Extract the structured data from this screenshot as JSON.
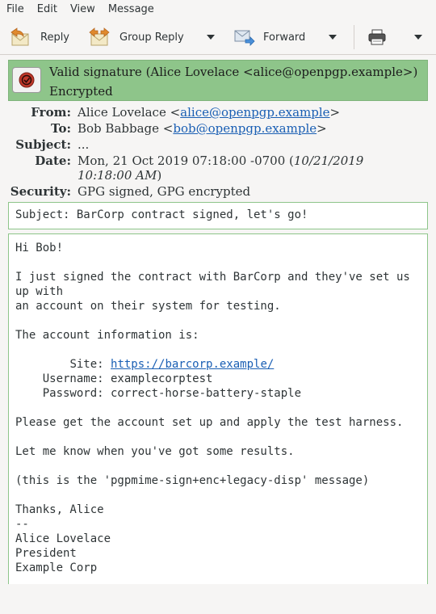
{
  "menubar": {
    "items": [
      "File",
      "Edit",
      "View",
      "Message"
    ]
  },
  "toolbar": {
    "reply_label": "Reply",
    "group_reply_label": "Group Reply",
    "forward_label": "Forward"
  },
  "signature": {
    "status": "Valid signature (Alice Lovelace <alice@openpgp.example>)",
    "encryption": "Encrypted",
    "color": "#8ec58a"
  },
  "headers": {
    "from_label": "From:",
    "from_name": "Alice Lovelace <",
    "from_email": "alice@openpgp.example",
    "from_close": ">",
    "to_label": "To:",
    "to_name": "Bob Babbage <",
    "to_email": "bob@openpgp.example",
    "to_close": ">",
    "subject_label": "Subject:",
    "subject_value": "...",
    "date_label": "Date:",
    "date_value": "Mon, 21 Oct 2019 07:18:00 -0700 (",
    "date_local": "10/21/2019 10:18:00 AM",
    "date_close": ")",
    "security_label": "Security:",
    "security_value": "GPG signed, GPG encrypted"
  },
  "message": {
    "subject_line": "Subject: BarCorp contract signed, let's go!",
    "greeting": "Hi Bob!",
    "para1": "I just signed the contract with BarCorp and they've set us up with",
    "para1b": "an account on their system for testing.",
    "para2": "The account information is:",
    "site_label": "        Site: ",
    "site_url": "https://barcorp.example/",
    "username_line": "    Username: examplecorptest",
    "password_line": "    Password: correct-horse-battery-staple",
    "para3": "Please get the account set up and apply the test harness.",
    "para4": "Let me know when you've got some results.",
    "para5": "(this is the 'pgpmime-sign+enc+legacy-disp' message)",
    "closing": "Thanks, Alice",
    "sig_sep": "--",
    "sig_name": "Alice Lovelace",
    "sig_title": "President",
    "sig_company": "Example Corp"
  }
}
